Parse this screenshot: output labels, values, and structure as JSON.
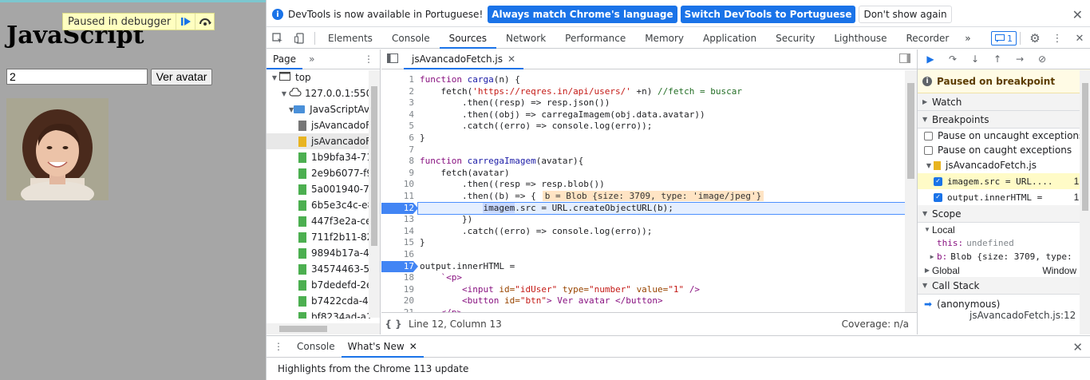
{
  "page": {
    "title": "JavaScript",
    "debugger_banner": "Paused in debugger",
    "id_input_value": "2",
    "button_label": "Ver avatar"
  },
  "infobar": {
    "message": "DevTools is now available in Portuguese!",
    "btn_match": "Always match Chrome's language",
    "btn_switch": "Switch DevTools to Portuguese",
    "btn_dismiss": "Don't show again"
  },
  "tabs": [
    "Elements",
    "Console",
    "Sources",
    "Network",
    "Performance",
    "Memory",
    "Application",
    "Security",
    "Lighthouse",
    "Recorder"
  ],
  "active_tab": "Sources",
  "issues_count": "1",
  "navigator": {
    "label": "Page",
    "tree": [
      {
        "label": "top",
        "type": "frame",
        "indent": 0
      },
      {
        "label": "127.0.0.1:5500",
        "type": "cloud",
        "indent": 1
      },
      {
        "label": "JavaScriptAvancado",
        "type": "folder",
        "indent": 2
      },
      {
        "label": "jsAvancadoFetch.html",
        "type": "file-gray",
        "indent": 3
      },
      {
        "label": "jsAvancadoFetch.js",
        "type": "file-yellow",
        "indent": 3,
        "selected": true
      },
      {
        "label": "1b9bfa34-71",
        "type": "file-green",
        "indent": 2
      },
      {
        "label": "2e9b6077-f9",
        "type": "file-green",
        "indent": 2
      },
      {
        "label": "5a001940-77",
        "type": "file-green",
        "indent": 2
      },
      {
        "label": "6b5e3c4c-e8",
        "type": "file-green",
        "indent": 2
      },
      {
        "label": "447f3e2a-ce",
        "type": "file-green",
        "indent": 2
      },
      {
        "label": "711f2b11-82",
        "type": "file-green",
        "indent": 2
      },
      {
        "label": "9894b17a-42",
        "type": "file-green",
        "indent": 2
      },
      {
        "label": "34574463-58",
        "type": "file-green",
        "indent": 2
      },
      {
        "label": "b7dedefd-2e",
        "type": "file-green",
        "indent": 2
      },
      {
        "label": "b7422cda-41",
        "type": "file-green",
        "indent": 2
      },
      {
        "label": "bf8234ad-a1",
        "type": "file-green",
        "indent": 2
      }
    ]
  },
  "editor": {
    "file_tab": "jsAvancadoFetch.js",
    "status_position": "Line 12, Column 13",
    "status_coverage": "Coverage: n/a",
    "inline_value": "b = Blob {size: 3709, type: 'image/jpeg'}",
    "breakpoint_lines": [
      12,
      17
    ],
    "current_line": 12,
    "lines": [
      [
        {
          "t": "function ",
          "c": "kw"
        },
        {
          "t": "carga",
          "c": "fn"
        },
        {
          "t": "(n) {",
          "c": ""
        }
      ],
      [
        {
          "t": "    fetch(",
          "c": ""
        },
        {
          "t": "'https://reqres.in/api/users/'",
          "c": "st"
        },
        {
          "t": " +n) ",
          "c": ""
        },
        {
          "t": "//fetch = buscar",
          "c": "cm"
        }
      ],
      [
        {
          "t": "        .then((resp) => resp.json())",
          "c": ""
        }
      ],
      [
        {
          "t": "        .then((obj) => carregaImagem(obj.data.avatar))",
          "c": ""
        }
      ],
      [
        {
          "t": "        .catch((erro) => console.log(erro));",
          "c": ""
        }
      ],
      [
        {
          "t": "}",
          "c": ""
        }
      ],
      [
        {
          "t": "",
          "c": ""
        }
      ],
      [
        {
          "t": "function ",
          "c": "kw"
        },
        {
          "t": "carregaImagem",
          "c": "fn"
        },
        {
          "t": "(avatar){",
          "c": ""
        }
      ],
      [
        {
          "t": "    fetch(avatar)",
          "c": ""
        }
      ],
      [
        {
          "t": "        .then((resp => resp.blob())",
          "c": ""
        }
      ],
      [
        {
          "t": "        .then((b) => {",
          "c": ""
        }
      ],
      [
        {
          "t": "            ",
          "c": ""
        },
        {
          "t": "imagem",
          "c": "hl"
        },
        {
          "t": ".src = URL.",
          "c": ""
        },
        {
          "t": "createObjectURL(b);",
          "c": ""
        }
      ],
      [
        {
          "t": "        })",
          "c": ""
        }
      ],
      [
        {
          "t": "        .catch((erro) => console.log(erro));",
          "c": ""
        }
      ],
      [
        {
          "t": "}",
          "c": ""
        }
      ],
      [
        {
          "t": "",
          "c": ""
        }
      ],
      [
        {
          "t": "output.innerHTML =",
          "c": ""
        }
      ],
      [
        {
          "t": "    `<p>",
          "c": "tag"
        }
      ],
      [
        {
          "t": "        <input ",
          "c": "tag"
        },
        {
          "t": "id=",
          "c": "at"
        },
        {
          "t": "\"idUser\" ",
          "c": "st"
        },
        {
          "t": "type=",
          "c": "at"
        },
        {
          "t": "\"number\" ",
          "c": "st"
        },
        {
          "t": "value=",
          "c": "at"
        },
        {
          "t": "\"1\" ",
          "c": "st"
        },
        {
          "t": "/>",
          "c": "tag"
        }
      ],
      [
        {
          "t": "        <button ",
          "c": "tag"
        },
        {
          "t": "id=",
          "c": "at"
        },
        {
          "t": "\"btn\"",
          "c": "st"
        },
        {
          "t": "> Ver avatar </button>",
          "c": "tag"
        }
      ],
      [
        {
          "t": "    </p>",
          "c": "tag"
        }
      ]
    ]
  },
  "debugger": {
    "paused_text": "Paused on breakpoint",
    "watch": "Watch",
    "breakpoints": "Breakpoints",
    "pause_uncaught": "Pause on uncaught exceptions",
    "pause_caught": "Pause on caught exceptions",
    "bp_file": "jsAvancadoFetch.js",
    "bp_items": [
      {
        "code": "imagem.src = URL....",
        "line": "12",
        "selected": true
      },
      {
        "code": "output.innerHTML =",
        "line": "17",
        "selected": false
      }
    ],
    "scope": "Scope",
    "local": "Local",
    "this_name": "this:",
    "this_value": "undefined",
    "b_name": "b:",
    "b_value": "Blob {size: 3709, type:",
    "global": "Global",
    "global_value": "Window",
    "call_stack": "Call Stack",
    "frame_name": "(anonymous)",
    "frame_location": "jsAvancadoFetch.js:12"
  },
  "drawer": {
    "tabs": [
      "Console",
      "What's New"
    ],
    "active": "What's New",
    "text": "Highlights from the Chrome 113 update"
  }
}
